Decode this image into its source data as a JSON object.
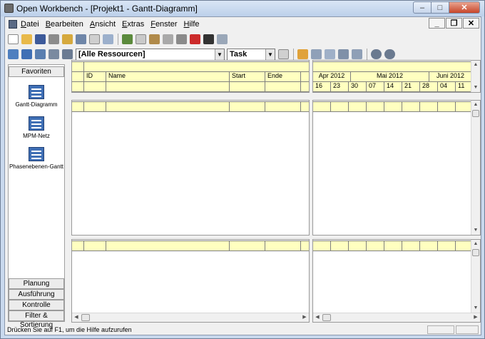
{
  "window": {
    "title": "Open Workbench - [Projekt1 - Gantt-Diagramm]"
  },
  "menu": [
    {
      "label": "Datei",
      "accel": "D",
      "rest": "atei"
    },
    {
      "label": "Bearbeiten",
      "accel": "B",
      "rest": "earbeiten"
    },
    {
      "label": "Ansicht",
      "accel": "A",
      "rest": "nsicht"
    },
    {
      "label": "Extras",
      "accel": "E",
      "rest": "xtras"
    },
    {
      "label": "Fenster",
      "accel": "F",
      "rest": "enster"
    },
    {
      "label": "Hilfe",
      "accel": "H",
      "rest": "ilfe"
    }
  ],
  "toolbar": {
    "resource_filter": "[Alle Ressourcen]",
    "type_filter": "Task"
  },
  "sidebar": {
    "favorites_label": "Favoriten",
    "views": [
      {
        "label": "Gantt-Diagramm",
        "icon": "gantt-icon"
      },
      {
        "label": "MPM-Netz",
        "icon": "network-icon"
      },
      {
        "label": "Phasenebenen-Gantt",
        "icon": "phase-gantt-icon"
      }
    ],
    "groups": [
      "Planung",
      "Ausführung",
      "Kontrolle",
      "Filter & Sortierung"
    ]
  },
  "grid": {
    "columns": [
      "ID",
      "Name",
      "Start",
      "Ende"
    ]
  },
  "timeline": {
    "months": [
      "Apr 2012",
      "Mai 2012",
      "Juni 2012"
    ],
    "days": [
      "16",
      "23",
      "30",
      "07",
      "14",
      "21",
      "28",
      "04",
      "11"
    ]
  },
  "status": {
    "text": "Drücken Sie auf F1, um die Hilfe aufzurufen"
  },
  "colors": {
    "row_fill": "#ffffc0",
    "title_bg": "#c9d9ee"
  }
}
